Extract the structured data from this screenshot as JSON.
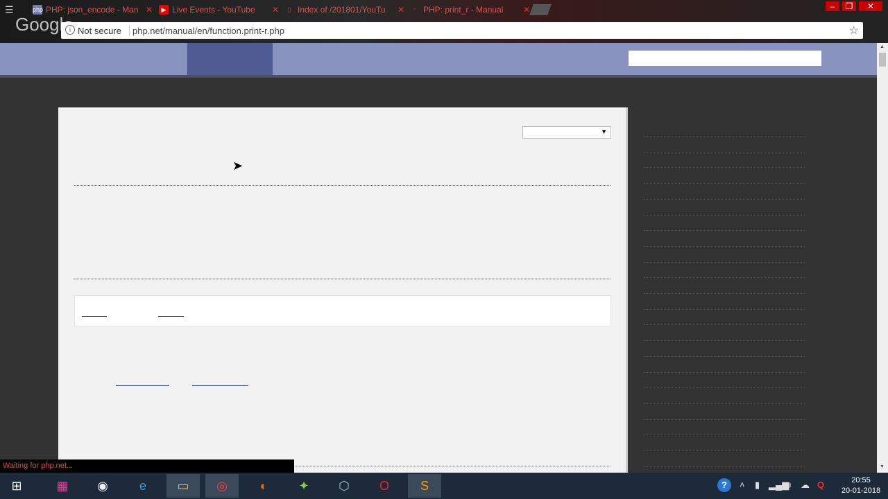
{
  "browser": {
    "tabs": [
      {
        "title": "PHP: json_encode - Man",
        "icon": "php-icon",
        "icon_text": "php"
      },
      {
        "title": "Live Events - YouTube",
        "icon": "youtube-icon"
      },
      {
        "title": "Index of /201801/YouTu",
        "icon": "file-icon"
      },
      {
        "title": "PHP: print_r - Manual",
        "icon": "loading-icon"
      }
    ],
    "brand": "Google",
    "omnibox": {
      "security": "Not secure",
      "url": "php.net/manual/en/function.print-r.php"
    },
    "status": "Waiting for php.net...",
    "window_controls": {
      "minimize": "‒",
      "restore": "❐",
      "close": "✕"
    }
  },
  "taskbar": {
    "apps": [
      {
        "name": "start",
        "icon": "windows-icon",
        "glyph": "⊞"
      },
      {
        "name": "colors-app",
        "icon": "palette-icon",
        "glyph": "▦"
      },
      {
        "name": "media-app",
        "icon": "disc-icon",
        "glyph": "◉"
      },
      {
        "name": "ie",
        "icon": "internet-explorer-icon",
        "glyph": "e"
      },
      {
        "name": "explorer",
        "icon": "folder-icon",
        "glyph": "▭"
      },
      {
        "name": "chrome",
        "icon": "chrome-icon",
        "glyph": "◎"
      },
      {
        "name": "firefox",
        "icon": "firefox-icon",
        "glyph": "◐"
      },
      {
        "name": "android-studio",
        "icon": "android-icon",
        "glyph": "✦"
      },
      {
        "name": "cube-app",
        "icon": "cube-icon",
        "glyph": "⬡"
      },
      {
        "name": "opera",
        "icon": "opera-icon",
        "glyph": "O"
      },
      {
        "name": "sublime",
        "icon": "sublime-icon",
        "glyph": "S"
      }
    ],
    "clock": {
      "time": "20:55",
      "date": "20-01-2018"
    },
    "tray": {
      "help": "?",
      "up": "˄",
      "q": "Q"
    }
  },
  "colors": {
    "nav": "#8892bf",
    "nav_active": "#4f5b93",
    "content_bg": "#f2f2f2",
    "page_bg": "#333333"
  }
}
